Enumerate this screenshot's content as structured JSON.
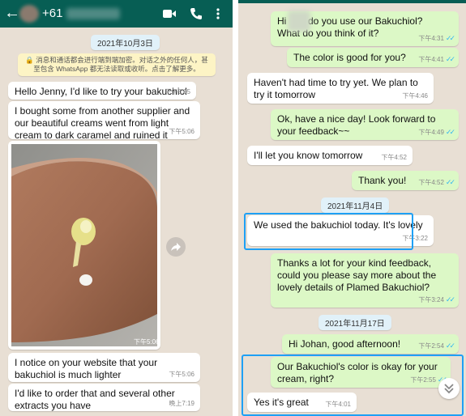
{
  "left": {
    "header": {
      "back_glyph": "←",
      "contact": "+61"
    },
    "date1": "2021年10月3日",
    "notice": "🔒 消息和通话都会进行端到端加密。对话之外的任何人，甚至包含 WhatsApp 都无法读取或收听。点击了解更多。",
    "messages": [
      {
        "text": "Hello Jenny, I'd like to try your bakuchiol",
        "time": "下午5:05"
      },
      {
        "text": "I bought some from another supplier and our beautiful creams went from light cream to dark caramel and ruined it",
        "time": "下午5:06"
      },
      {
        "time": "下午5:06"
      },
      {
        "text": "I notice on your website that your bakuchiol is much lighter",
        "time": "下午5:06"
      },
      {
        "text": "I'd like to order that and several other extracts you have",
        "time": "晚上7:19"
      }
    ]
  },
  "right": {
    "messages": [
      {
        "text_a": "Hi",
        "text_b": ", do you use our Bakuchiol?",
        "text_c": "What do you think of it?",
        "time": "下午4:31"
      },
      {
        "text": "The color is good for you?",
        "time": "下午4:41"
      },
      {
        "text": "Haven't had time to try yet. We plan to try it tomorrow",
        "time": "下午4:46"
      },
      {
        "text": "Ok, have a nice day!  Look forward to your feedback~~",
        "time": "下午4:49"
      },
      {
        "text": "I'll let you know tomorrow",
        "time": "下午4:52"
      },
      {
        "text": "Thank you!",
        "time": "下午4:52"
      },
      {
        "text": "We used the bakuchiol today. It's lovely",
        "time": "下午3:22"
      },
      {
        "text": "Thanks a lot for your kind feedback, could you please say more about the lovely details of Plamed Bakuchiol?",
        "time": "下午3:24"
      },
      {
        "text": "Hi Johan, good afternoon!",
        "time": "下午2:54"
      },
      {
        "text": "Our Bakuchiol's color is okay for your cream, right?",
        "time": "下午2:55"
      },
      {
        "text": "Yes it's great",
        "time": "下午4:01"
      }
    ],
    "date2": "2021年11月4日",
    "date3": "2021年11月17日",
    "ticks": "✓✓"
  }
}
